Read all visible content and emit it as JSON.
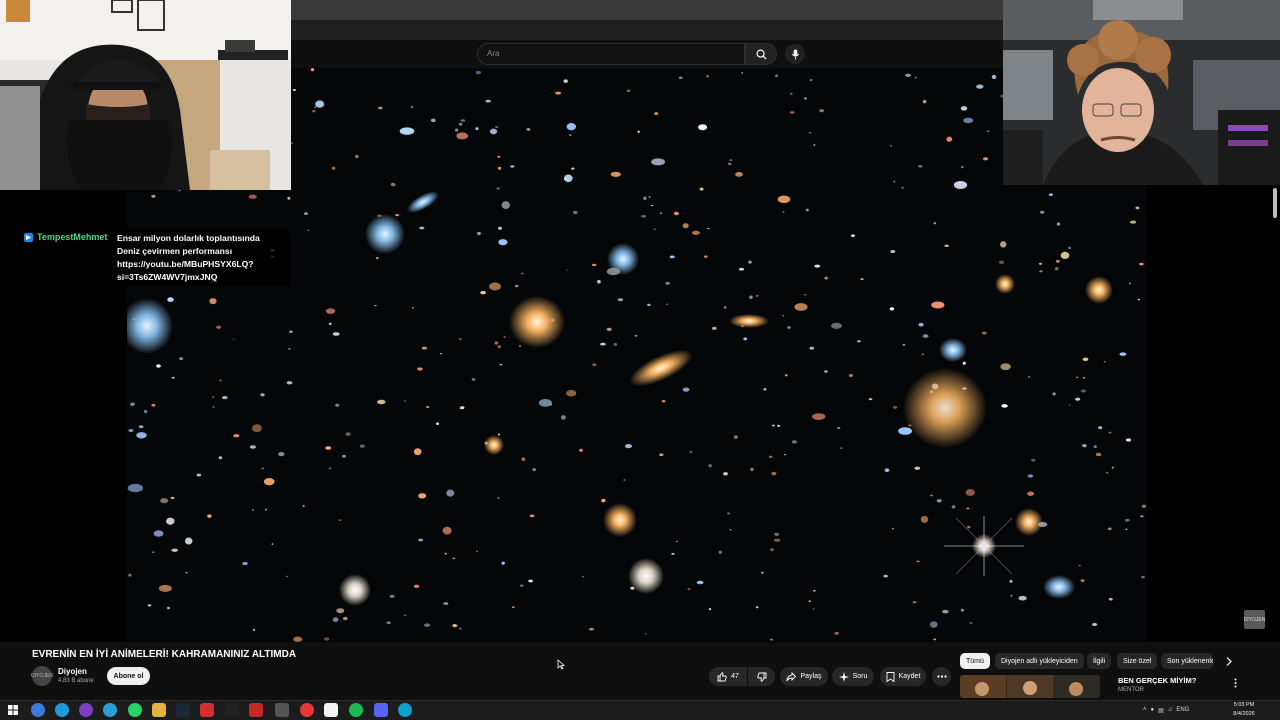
{
  "search": {
    "placeholder": "Ara"
  },
  "chat": {
    "username": "TempestMehmet",
    "message": "Ensar milyon dolarlık toplantısında Deniz çevirmen performansı https://youtu.be/MBuPHSYX6LQ?si=3Ts6ZW4WV7jmxJNQ"
  },
  "video": {
    "title": "EVRENİN EN İYİ ANİMELERİ! KAHRAMANINIZ ALTIMDA",
    "channel": "Diyojen",
    "subscribers": "4,83 B abone",
    "subscribe_label": "Abone ol",
    "likes": "47",
    "share_label": "Paylaş",
    "ask_label": "Soru",
    "save_label": "Kaydet",
    "avatar_text": "DIYOJEN"
  },
  "chips": [
    "Tümü",
    "Diyojen adlı yükleyiciden",
    "İlgili",
    "Size özel",
    "Son yüklenenler"
  ],
  "recommendation": {
    "title": "BEN GERÇEK MİYİM?",
    "channel": "MENTOR"
  },
  "watermark": "DIYOJEN",
  "taskbar": {
    "language": "ENG",
    "time": "5:03 PM",
    "date": "8/4/2026"
  },
  "colors": {
    "chat_username": "#3ddc84",
    "subscribe_bg": "#f1f1f1",
    "accent_blue": "#1e88e5"
  },
  "icons": [
    "search-icon",
    "mic-icon",
    "like-icon",
    "dislike-icon",
    "share-icon",
    "sparkle-icon",
    "bookmark-icon",
    "more-icon",
    "chevron-right-icon",
    "windows-start-icon"
  ]
}
